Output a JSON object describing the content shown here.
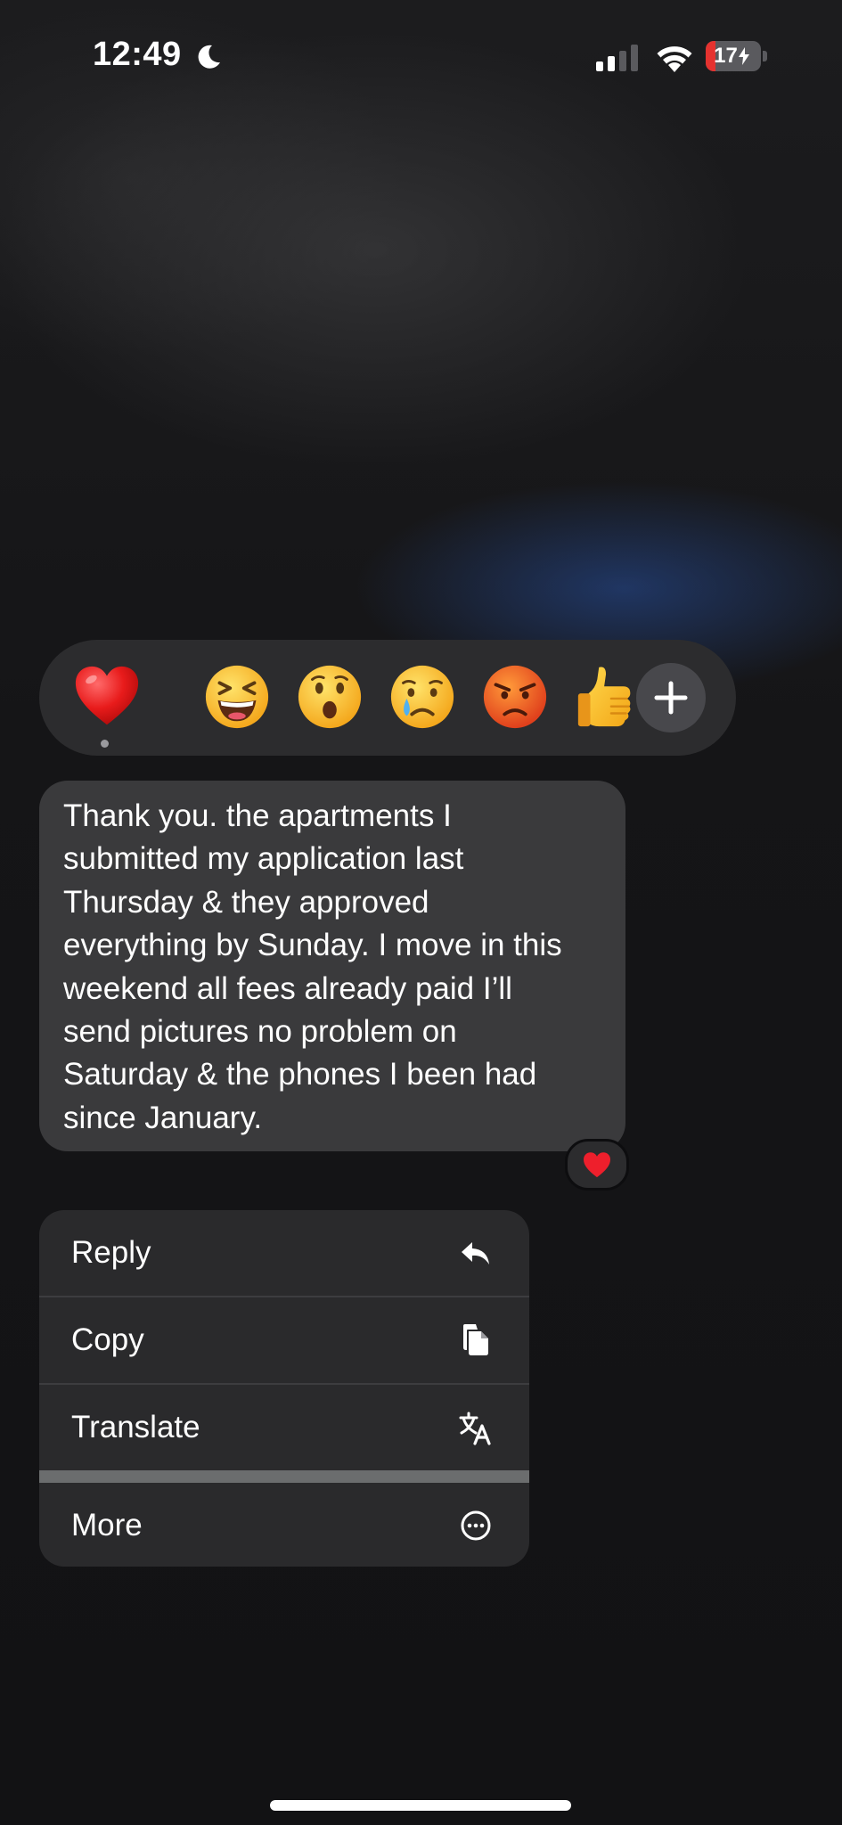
{
  "status_bar": {
    "time": "12:49",
    "focus_icon": "moon-icon",
    "signal_icon": "cellular-signal-icon",
    "wifi_icon": "wifi-icon",
    "battery_level": "17",
    "battery_percent": 17,
    "battery_charging": true,
    "battery_color": "#e5322f"
  },
  "reaction_bar": {
    "reactions": [
      {
        "name": "heart",
        "icon": "red-heart-icon",
        "selected": true
      },
      {
        "name": "laughing",
        "icon": "laughing-face-icon"
      },
      {
        "name": "surprised",
        "icon": "surprised-face-icon"
      },
      {
        "name": "sad",
        "icon": "crying-face-icon"
      },
      {
        "name": "angry",
        "icon": "angry-face-icon"
      },
      {
        "name": "thumbs-up",
        "icon": "thumbs-up-icon"
      }
    ],
    "more_icon": "plus-icon"
  },
  "message": {
    "text": "Thank you. the apartments I\nsubmitted my application last\nThursday & they approved\neverything by Sunday. I move in this\nweekend all fees already paid I’ll\nsend pictures no problem on\nSaturday & the phones I been had\nsince January.",
    "tapback_icon": "red-heart-icon"
  },
  "context_menu": {
    "items": [
      {
        "label": "Reply",
        "icon": "reply-arrow-icon"
      },
      {
        "label": "Copy",
        "icon": "copy-icon"
      },
      {
        "label": "Translate",
        "icon": "translate-icon"
      },
      {
        "label": "More",
        "icon": "ellipsis-circle-icon"
      }
    ]
  },
  "colors": {
    "bubble": "#3a3a3c",
    "menu": "#2a2a2c",
    "reaction_bar": "#2c2c2e"
  }
}
